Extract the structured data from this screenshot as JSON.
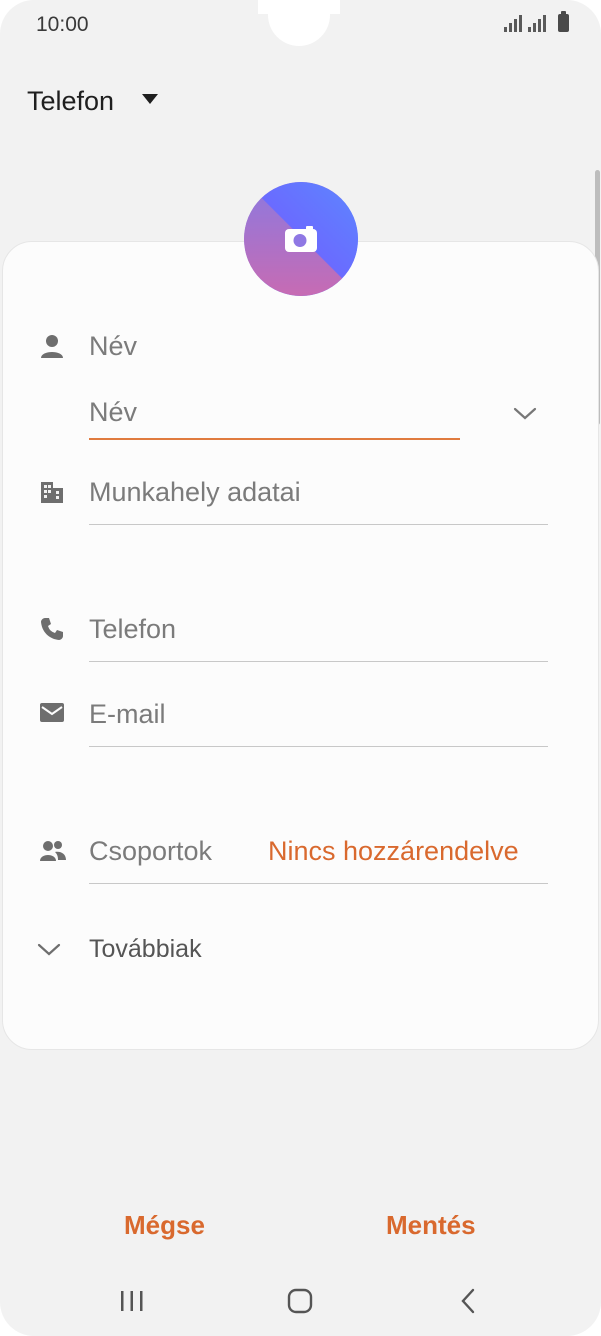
{
  "status_bar": {
    "time": "10:00"
  },
  "header": {
    "title": "Telefon"
  },
  "form": {
    "name_label": "Név",
    "name_input_placeholder": "Név",
    "work_label": "Munkahely adatai",
    "phone_label": "Telefon",
    "email_label": "E-mail",
    "groups_label": "Csoportok",
    "groups_value": "Nincs hozzárendelve",
    "more_label": "Továbbiak"
  },
  "footer": {
    "cancel_label": "Mégse",
    "save_label": "Mentés"
  },
  "colors": {
    "accent": "#d9692e",
    "text_muted": "#7b7b7b",
    "background": "#f2f2f2"
  },
  "icons": [
    "person-icon",
    "building-icon",
    "phone-icon",
    "mail-icon",
    "group-icon",
    "chevron-down-icon",
    "camera-icon",
    "recents-icon",
    "home-icon",
    "back-icon"
  ]
}
